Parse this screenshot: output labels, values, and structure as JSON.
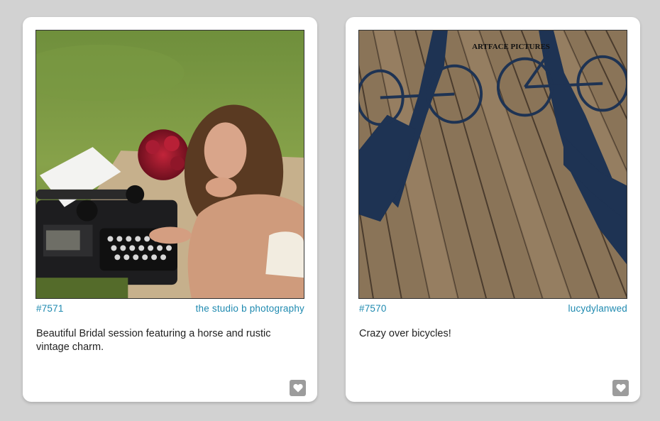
{
  "cards": [
    {
      "number": "#7571",
      "author": "the studio b photography",
      "description": "Beautiful Bridal session featuring a horse and rustic vintage charm.",
      "photo_icon": "bridal-typewriter-photo",
      "like_icon": "heart-icon"
    },
    {
      "number": "#7570",
      "author": "lucydylanwed",
      "description": "Crazy over bicycles!",
      "photo_icon": "bicycle-shadow-photo",
      "photo_caption": "ARTFACE PICTURES",
      "like_icon": "heart-icon"
    }
  ],
  "colors": {
    "page_background": "#d2d2d2",
    "card_background": "#ffffff",
    "link": "#1f8ab0",
    "like_button": "#9c9c9c"
  }
}
